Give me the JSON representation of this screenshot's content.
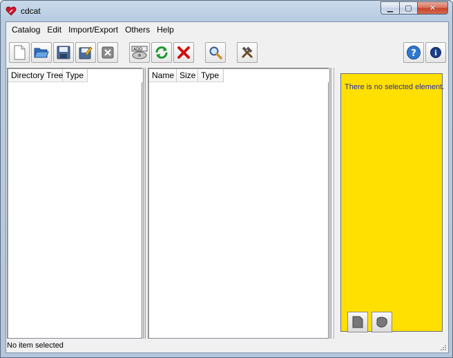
{
  "window": {
    "title": "cdcat",
    "minimize_icon": "minimize-icon",
    "maximize_icon": "maximize-icon",
    "close_icon": "close-icon"
  },
  "menu": [
    {
      "label": "Catalog"
    },
    {
      "label": "Edit"
    },
    {
      "label": "Import/Export"
    },
    {
      "label": "Others"
    },
    {
      "label": "Help"
    }
  ],
  "toolbar": {
    "buttons": [
      {
        "name": "new-catalog",
        "icon": "new-document-icon"
      },
      {
        "name": "open-catalog",
        "icon": "open-folder-icon"
      },
      {
        "name": "save-catalog",
        "icon": "save-disk-icon"
      },
      {
        "name": "save-as",
        "icon": "save-as-icon"
      },
      {
        "name": "close-catalog",
        "icon": "close-box-icon"
      },
      {
        "name": "add-media",
        "icon": "add-media-icon"
      },
      {
        "name": "rescan",
        "icon": "refresh-icon"
      },
      {
        "name": "delete",
        "icon": "delete-x-icon"
      },
      {
        "name": "search",
        "icon": "magnifier-icon"
      },
      {
        "name": "config",
        "icon": "tools-icon"
      },
      {
        "name": "help",
        "icon": "help-icon"
      },
      {
        "name": "about",
        "icon": "info-icon"
      }
    ]
  },
  "tree_pane": {
    "columns": [
      "Directory Tree",
      "Type"
    ]
  },
  "list_pane": {
    "columns": [
      "Name",
      "Size",
      "Type"
    ]
  },
  "info_panel": {
    "message": "There is no selected element.",
    "background": "#ffe000",
    "text_color": "#2a2ab0"
  },
  "status": {
    "text": "No item selected"
  }
}
